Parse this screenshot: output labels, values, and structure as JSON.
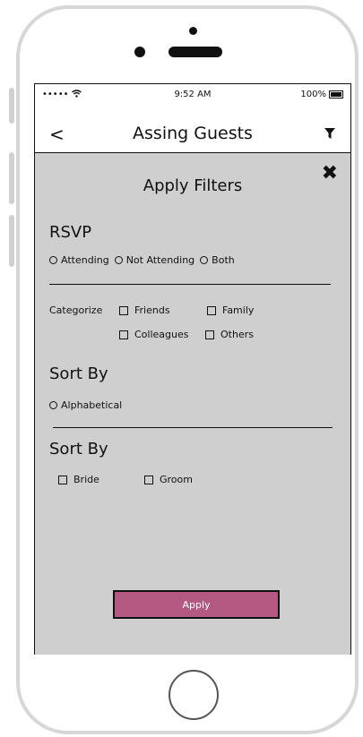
{
  "status_bar": {
    "signal": "••••• ",
    "time": "9:52 AM",
    "battery": "100%"
  },
  "nav": {
    "back": "<",
    "title": "Assing Guests"
  },
  "filters": {
    "title": "Apply Filters",
    "close": "✖",
    "rsvp": {
      "heading": "RSVP",
      "options": [
        "Attending",
        "Not Attending",
        "Both"
      ]
    },
    "categorize": {
      "label": "Categorize",
      "options": [
        "Friends",
        "Family",
        "Colleagues",
        "Others"
      ]
    },
    "sort1": {
      "heading": "Sort By",
      "options": [
        "Alphabetical"
      ]
    },
    "sort2": {
      "heading": "Sort By",
      "options": [
        "Bride",
        "Groom"
      ]
    },
    "apply_label": "Apply"
  }
}
